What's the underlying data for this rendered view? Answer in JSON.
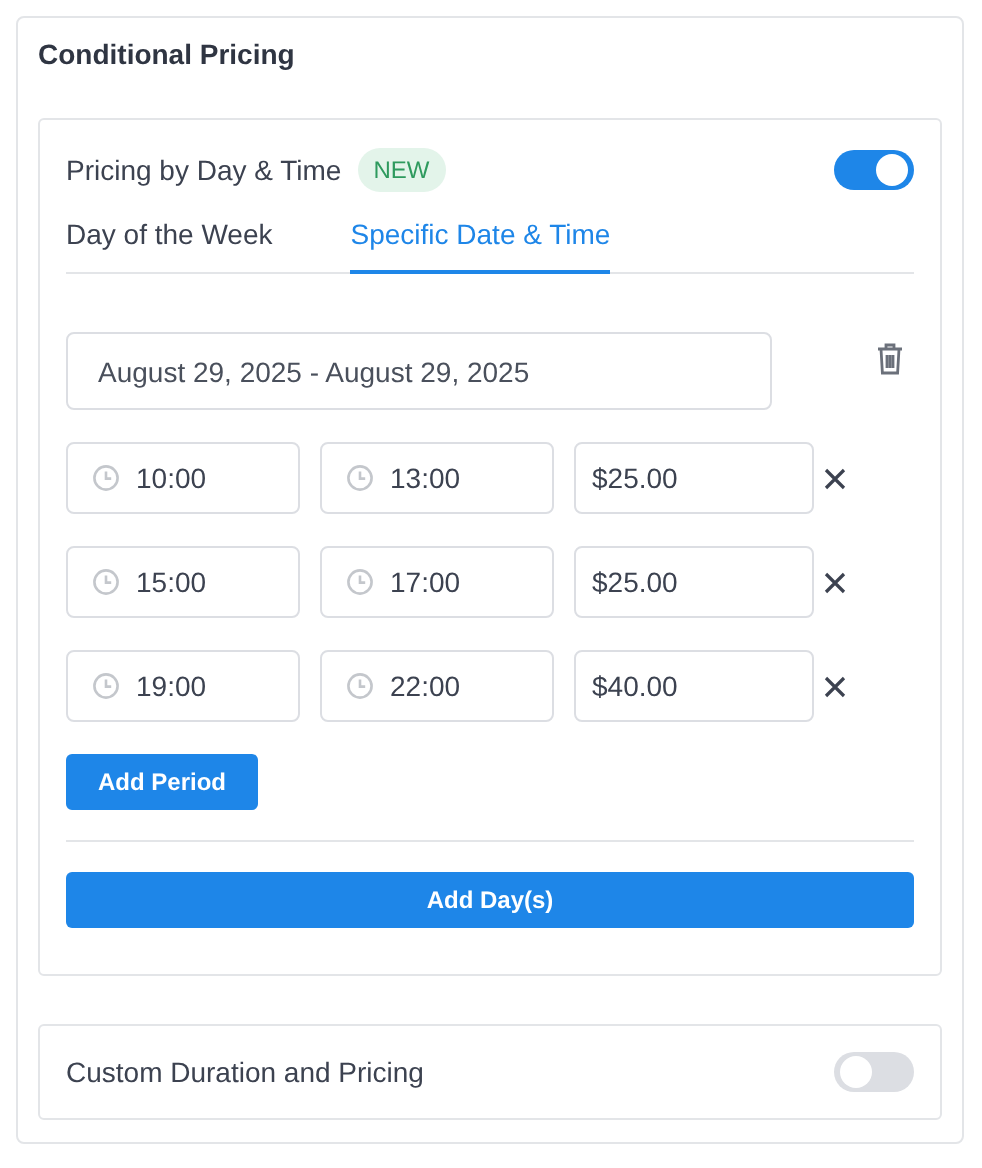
{
  "title": "Conditional Pricing",
  "pricing": {
    "label": "Pricing by Day & Time",
    "badge": "NEW",
    "on": true,
    "tabs": [
      {
        "label": "Day of the Week",
        "selected": false
      },
      {
        "label": "Specific Date & Time",
        "selected": true
      }
    ],
    "date_range": "August 29, 2025 - August 29, 2025",
    "periods": [
      {
        "start": "10:00",
        "end": "13:00",
        "price": "$25.00"
      },
      {
        "start": "15:00",
        "end": "17:00",
        "price": "$25.00"
      },
      {
        "start": "19:00",
        "end": "22:00",
        "price": "$40.00"
      }
    ],
    "add_period": "Add Period",
    "add_days": "Add Day(s)"
  },
  "custom": {
    "label": "Custom Duration and Pricing",
    "on": false
  }
}
